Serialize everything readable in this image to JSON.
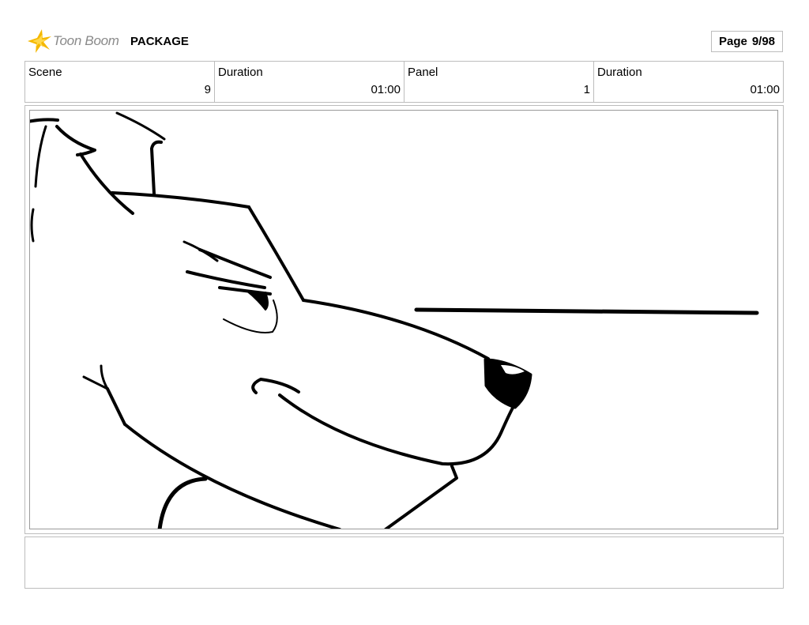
{
  "header": {
    "logo_text": "Toon Boom",
    "logo_icon": "star-burst-icon",
    "title": "PACKAGE",
    "page_label": "Page",
    "page_value": "9/98"
  },
  "info": {
    "scene_label": "Scene",
    "scene_value": "9",
    "scene_duration_label": "Duration",
    "scene_duration_value": "01:00",
    "panel_label": "Panel",
    "panel_value": "1",
    "panel_duration_label": "Duration",
    "panel_duration_value": "01:00"
  },
  "panel": {
    "content": "sketch-drawing"
  },
  "notes": {
    "text": ""
  },
  "colors": {
    "logo_accent": "#f5b800",
    "border": "#bdbdbd",
    "ink": "#000000"
  }
}
